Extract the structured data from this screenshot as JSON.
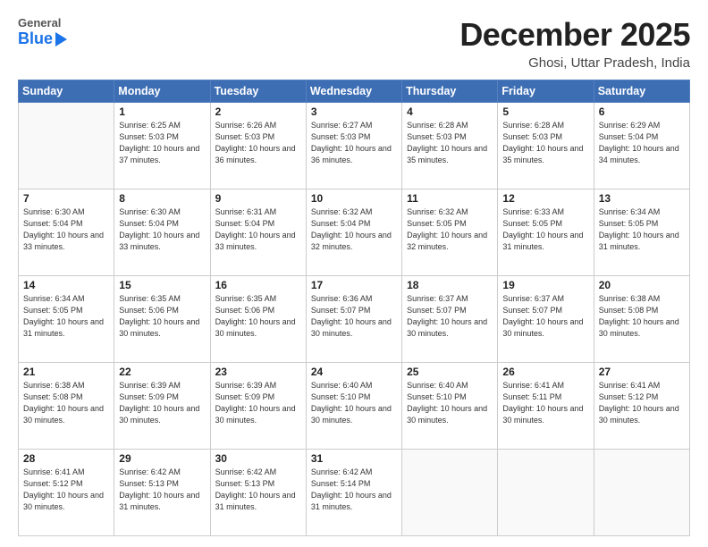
{
  "header": {
    "logo_general": "General",
    "logo_blue": "Blue",
    "month": "December 2025",
    "location": "Ghosi, Uttar Pradesh, India"
  },
  "days_of_week": [
    "Sunday",
    "Monday",
    "Tuesday",
    "Wednesday",
    "Thursday",
    "Friday",
    "Saturday"
  ],
  "weeks": [
    [
      {
        "day": "",
        "info": ""
      },
      {
        "day": "1",
        "info": "Sunrise: 6:25 AM\nSunset: 5:03 PM\nDaylight: 10 hours\nand 37 minutes."
      },
      {
        "day": "2",
        "info": "Sunrise: 6:26 AM\nSunset: 5:03 PM\nDaylight: 10 hours\nand 36 minutes."
      },
      {
        "day": "3",
        "info": "Sunrise: 6:27 AM\nSunset: 5:03 PM\nDaylight: 10 hours\nand 36 minutes."
      },
      {
        "day": "4",
        "info": "Sunrise: 6:28 AM\nSunset: 5:03 PM\nDaylight: 10 hours\nand 35 minutes."
      },
      {
        "day": "5",
        "info": "Sunrise: 6:28 AM\nSunset: 5:03 PM\nDaylight: 10 hours\nand 35 minutes."
      },
      {
        "day": "6",
        "info": "Sunrise: 6:29 AM\nSunset: 5:04 PM\nDaylight: 10 hours\nand 34 minutes."
      }
    ],
    [
      {
        "day": "7",
        "info": "Sunrise: 6:30 AM\nSunset: 5:04 PM\nDaylight: 10 hours\nand 33 minutes."
      },
      {
        "day": "8",
        "info": "Sunrise: 6:30 AM\nSunset: 5:04 PM\nDaylight: 10 hours\nand 33 minutes."
      },
      {
        "day": "9",
        "info": "Sunrise: 6:31 AM\nSunset: 5:04 PM\nDaylight: 10 hours\nand 33 minutes."
      },
      {
        "day": "10",
        "info": "Sunrise: 6:32 AM\nSunset: 5:04 PM\nDaylight: 10 hours\nand 32 minutes."
      },
      {
        "day": "11",
        "info": "Sunrise: 6:32 AM\nSunset: 5:05 PM\nDaylight: 10 hours\nand 32 minutes."
      },
      {
        "day": "12",
        "info": "Sunrise: 6:33 AM\nSunset: 5:05 PM\nDaylight: 10 hours\nand 31 minutes."
      },
      {
        "day": "13",
        "info": "Sunrise: 6:34 AM\nSunset: 5:05 PM\nDaylight: 10 hours\nand 31 minutes."
      }
    ],
    [
      {
        "day": "14",
        "info": "Sunrise: 6:34 AM\nSunset: 5:05 PM\nDaylight: 10 hours\nand 31 minutes."
      },
      {
        "day": "15",
        "info": "Sunrise: 6:35 AM\nSunset: 5:06 PM\nDaylight: 10 hours\nand 30 minutes."
      },
      {
        "day": "16",
        "info": "Sunrise: 6:35 AM\nSunset: 5:06 PM\nDaylight: 10 hours\nand 30 minutes."
      },
      {
        "day": "17",
        "info": "Sunrise: 6:36 AM\nSunset: 5:07 PM\nDaylight: 10 hours\nand 30 minutes."
      },
      {
        "day": "18",
        "info": "Sunrise: 6:37 AM\nSunset: 5:07 PM\nDaylight: 10 hours\nand 30 minutes."
      },
      {
        "day": "19",
        "info": "Sunrise: 6:37 AM\nSunset: 5:07 PM\nDaylight: 10 hours\nand 30 minutes."
      },
      {
        "day": "20",
        "info": "Sunrise: 6:38 AM\nSunset: 5:08 PM\nDaylight: 10 hours\nand 30 minutes."
      }
    ],
    [
      {
        "day": "21",
        "info": "Sunrise: 6:38 AM\nSunset: 5:08 PM\nDaylight: 10 hours\nand 30 minutes."
      },
      {
        "day": "22",
        "info": "Sunrise: 6:39 AM\nSunset: 5:09 PM\nDaylight: 10 hours\nand 30 minutes."
      },
      {
        "day": "23",
        "info": "Sunrise: 6:39 AM\nSunset: 5:09 PM\nDaylight: 10 hours\nand 30 minutes."
      },
      {
        "day": "24",
        "info": "Sunrise: 6:40 AM\nSunset: 5:10 PM\nDaylight: 10 hours\nand 30 minutes."
      },
      {
        "day": "25",
        "info": "Sunrise: 6:40 AM\nSunset: 5:10 PM\nDaylight: 10 hours\nand 30 minutes."
      },
      {
        "day": "26",
        "info": "Sunrise: 6:41 AM\nSunset: 5:11 PM\nDaylight: 10 hours\nand 30 minutes."
      },
      {
        "day": "27",
        "info": "Sunrise: 6:41 AM\nSunset: 5:12 PM\nDaylight: 10 hours\nand 30 minutes."
      }
    ],
    [
      {
        "day": "28",
        "info": "Sunrise: 6:41 AM\nSunset: 5:12 PM\nDaylight: 10 hours\nand 30 minutes."
      },
      {
        "day": "29",
        "info": "Sunrise: 6:42 AM\nSunset: 5:13 PM\nDaylight: 10 hours\nand 31 minutes."
      },
      {
        "day": "30",
        "info": "Sunrise: 6:42 AM\nSunset: 5:13 PM\nDaylight: 10 hours\nand 31 minutes."
      },
      {
        "day": "31",
        "info": "Sunrise: 6:42 AM\nSunset: 5:14 PM\nDaylight: 10 hours\nand 31 minutes."
      },
      {
        "day": "",
        "info": ""
      },
      {
        "day": "",
        "info": ""
      },
      {
        "day": "",
        "info": ""
      }
    ]
  ]
}
